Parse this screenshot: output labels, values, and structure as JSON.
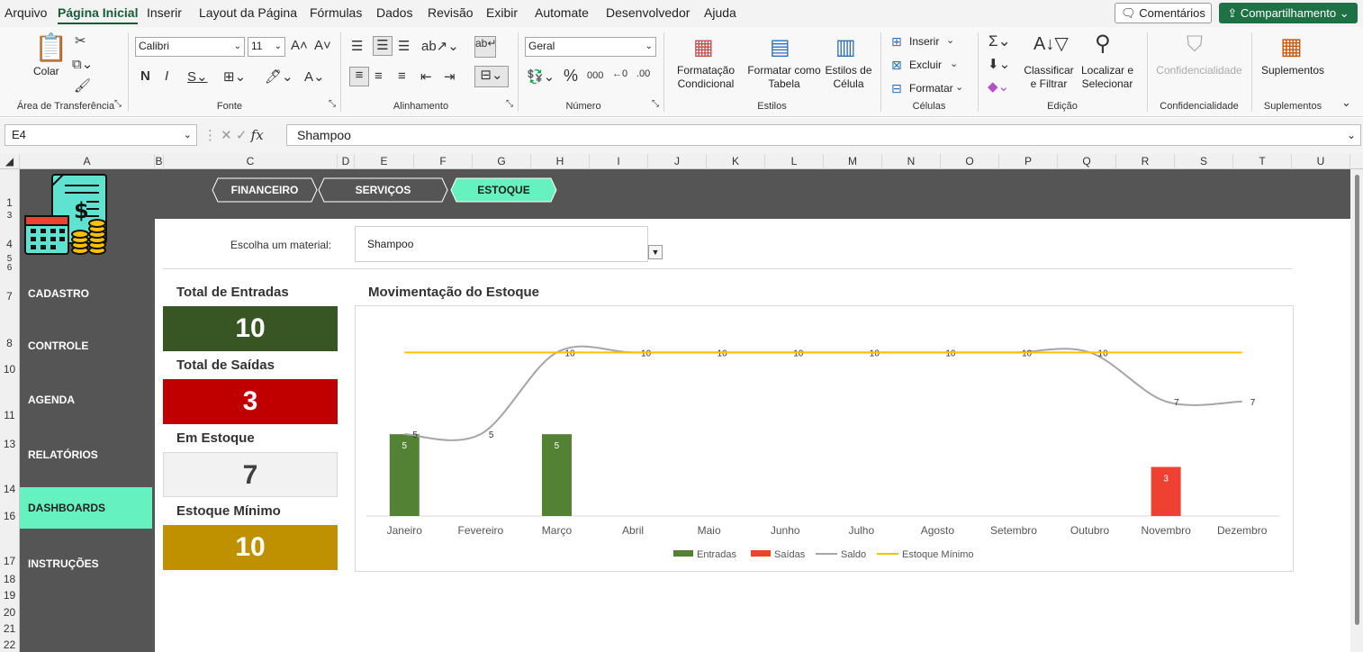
{
  "menu": {
    "tabs": [
      "Arquivo",
      "Página Inicial",
      "Inserir",
      "Layout da Página",
      "Fórmulas",
      "Dados",
      "Revisão",
      "Exibir",
      "Automate",
      "Desenvolvedor",
      "Ajuda"
    ],
    "comments_label": "Comentários",
    "share_label": "Compartilhamento"
  },
  "ribbon": {
    "clipboard": {
      "paste_label": "Colar",
      "group": "Área de Transferência"
    },
    "font": {
      "name": "Calibri",
      "size": "11",
      "group": "Fonte"
    },
    "alignment": {
      "group": "Alinhamento"
    },
    "number": {
      "format": "Geral",
      "group": "Número"
    },
    "styles": {
      "cond_format": "Formatação Condicional",
      "format_table": "Formatar como Tabela",
      "cell_styles": "Estilos de Célula",
      "group": "Estilos"
    },
    "cells": {
      "insert": "Inserir",
      "delete": "Excluir",
      "format": "Formatar",
      "group": "Células"
    },
    "editing": {
      "sort_filter": "Classificar e Filtrar",
      "find_select": "Localizar e Selecionar",
      "group": "Edição"
    },
    "sensitivity": {
      "label": "Confidencialidade",
      "group": "Confidencialidade"
    },
    "addins": {
      "label": "Suplementos",
      "group": "Suplementos"
    }
  },
  "formula_bar": {
    "cell_ref": "E4",
    "value": "Shampoo"
  },
  "columns": [
    "A",
    "B",
    "C",
    "D",
    "E",
    "F",
    "G",
    "H",
    "I",
    "J",
    "K",
    "L",
    "M",
    "N",
    "O",
    "P",
    "Q",
    "R",
    "S",
    "T",
    "U"
  ],
  "rows": [
    "1",
    "3",
    "4",
    "5",
    "6",
    "7",
    "8",
    "10",
    "11",
    "13",
    "14",
    "16",
    "17",
    "18",
    "19",
    "20",
    "21",
    "22"
  ],
  "nav_tabs": [
    "FINANCEIRO",
    "SERVIÇOS",
    "ESTOQUE"
  ],
  "sidebar": [
    "CADASTRO",
    "CONTROLE",
    "AGENDA",
    "RELATÓRIOS",
    "DASHBOARDS",
    "INSTRUÇÕES"
  ],
  "material": {
    "label": "Escolha um material:",
    "value": "Shampoo"
  },
  "kpis": [
    {
      "title": "Total de Entradas",
      "value": "10",
      "bg": "#375623",
      "fg": "#ffffff"
    },
    {
      "title": "Total de Saídas",
      "value": "3",
      "bg": "#c00000",
      "fg": "#ffffff"
    },
    {
      "title": "Em Estoque",
      "value": "7",
      "bg": "#f2f2f2",
      "fg": "#404040"
    },
    {
      "title": "Estoque Mínimo",
      "value": "10",
      "bg": "#bf9000",
      "fg": "#ffffff"
    }
  ],
  "colors": {
    "accent": "#66f2c0",
    "panel": "#555555",
    "entradas": "#548235",
    "saidas": "#ee4132",
    "saldo": "#a6a6a6",
    "estoque_minimo": "#ffc000"
  },
  "chart_data": {
    "type": "bar",
    "title": "Movimentação do Estoque",
    "categories": [
      "Janeiro",
      "Fevereiro",
      "Março",
      "Abril",
      "Maio",
      "Junho",
      "Julho",
      "Agosto",
      "Setembro",
      "Outubro",
      "Novembro",
      "Dezembro"
    ],
    "series": [
      {
        "name": "Entradas",
        "kind": "bar",
        "values": [
          5,
          0,
          5,
          0,
          0,
          0,
          0,
          0,
          0,
          0,
          0,
          0
        ]
      },
      {
        "name": "Saídas",
        "kind": "bar",
        "values": [
          0,
          0,
          0,
          0,
          0,
          0,
          0,
          0,
          0,
          0,
          3,
          0
        ]
      },
      {
        "name": "Saldo",
        "kind": "line",
        "values": [
          5,
          5,
          10,
          10,
          10,
          10,
          10,
          10,
          10,
          10,
          7,
          7
        ]
      },
      {
        "name": "Estoque Mínimo",
        "kind": "line",
        "values": [
          10,
          10,
          10,
          10,
          10,
          10,
          10,
          10,
          10,
          10,
          10,
          10
        ]
      }
    ],
    "ylim": [
      0,
      12
    ],
    "grid": false,
    "legend": "bottom"
  }
}
